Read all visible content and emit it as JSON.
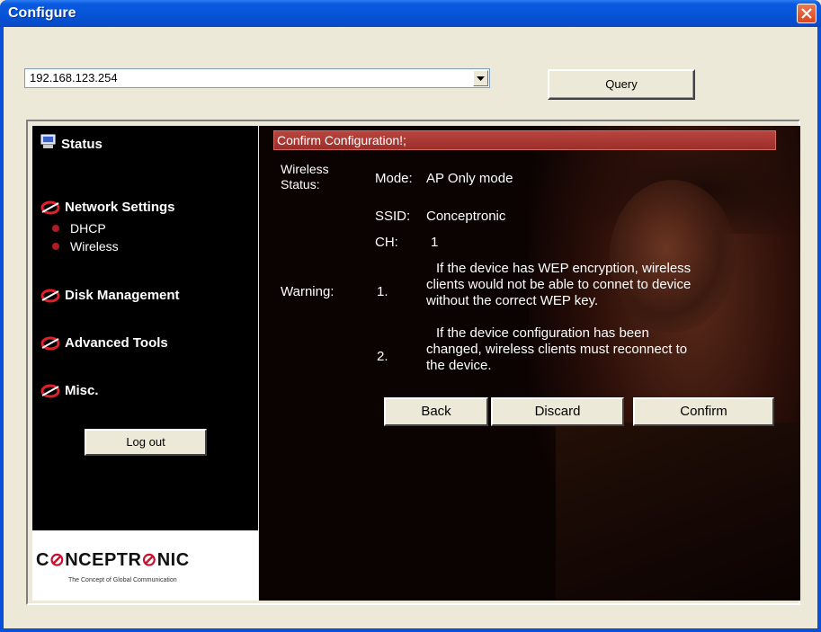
{
  "window": {
    "title": "Configure"
  },
  "address": {
    "value": "192.168.123.254"
  },
  "toolbar": {
    "query_label": "Query"
  },
  "sidebar": {
    "status_label": "Status",
    "network_settings_label": "Network Settings",
    "dhcp_label": "DHCP",
    "wireless_label": "Wireless",
    "disk_management_label": "Disk Management",
    "advanced_tools_label": "Advanced Tools",
    "misc_label": "Misc.",
    "logout_label": "Log out",
    "logo_text_1": "C",
    "logo_text_2": "NCEPTR",
    "logo_text_3": "NIC",
    "logo_tagline": "The Concept of Global Communication"
  },
  "content": {
    "header": "Confirm Configuration!;",
    "wireless_label_1": "Wireless",
    "wireless_label_2": "Status:",
    "mode_label": "Mode:",
    "mode_value": "AP Only mode",
    "ssid_label": "SSID:",
    "ssid_value": "Conceptronic",
    "ch_label": "CH:",
    "ch_value": "1",
    "warning_label": "Warning:",
    "warning1_num": "1.",
    "warning1_line1": "If the device has WEP encryption, wireless",
    "warning1_line2": "clients would not be able to connet to device",
    "warning1_line3": "without the correct WEP key.",
    "warning2_num": "2.",
    "warning2_line1": "If the device configuration has been",
    "warning2_line2": "changed, wireless clients must reconnect to",
    "warning2_line3": "the device.",
    "back_label": "Back",
    "discard_label": "Discard",
    "confirm_label": "Confirm"
  },
  "colors": {
    "titlebar": "#0553d6",
    "header_bar": "#9c2e29",
    "bullet": "#b01c22",
    "logo_accent": "#c8102e"
  }
}
